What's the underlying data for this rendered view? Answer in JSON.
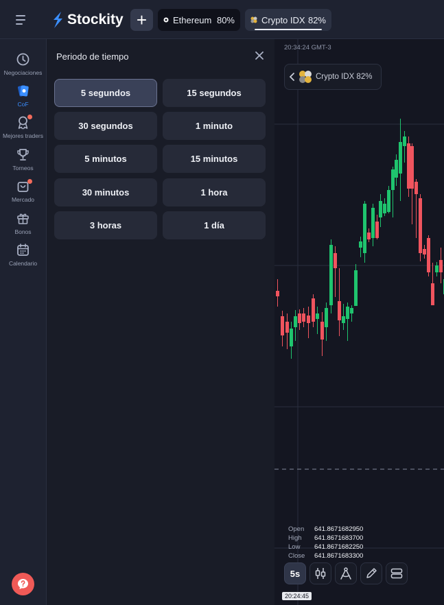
{
  "header": {
    "logo_text": "Stockity",
    "add_label": "+",
    "assets": [
      {
        "name": "Ethereum",
        "percent": "80%"
      },
      {
        "name": "Crypto IDX",
        "percent": "82%"
      }
    ]
  },
  "sidebar": {
    "items": [
      {
        "label": "Negociaciones",
        "icon": "clock-icon"
      },
      {
        "label": "CoF",
        "icon": "cards-icon"
      },
      {
        "label": "Mejores traders",
        "icon": "medal-icon"
      },
      {
        "label": "Torneos",
        "icon": "trophy-icon"
      },
      {
        "label": "Mercado",
        "icon": "bag-icon"
      },
      {
        "label": "Bonos",
        "icon": "gift-icon"
      },
      {
        "label": "Calendario",
        "icon": "calendar-icon"
      }
    ]
  },
  "panel": {
    "title": "Periodo de tiempo",
    "options": [
      "5 segundos",
      "15 segundos",
      "30 segundos",
      "1 minuto",
      "5 minutos",
      "15 minutos",
      "30 minutos",
      "1 hora",
      "3 horas",
      "1 día"
    ],
    "selected": "5 segundos"
  },
  "chart": {
    "time_label": "20:34:24 GMT-3",
    "asset_label": "Crypto IDX 82%",
    "ohlc": [
      {
        "key": "Open",
        "value": "641.8671682950"
      },
      {
        "key": "High",
        "value": "641.8671683700"
      },
      {
        "key": "Low",
        "value": "641.8671682250"
      },
      {
        "key": "Close",
        "value": "641.8671683300"
      }
    ],
    "timeframe_label": "5s",
    "time_tag": "20:24:45",
    "colors": {
      "up": "#1fc46e",
      "down": "#f0545e"
    }
  }
}
